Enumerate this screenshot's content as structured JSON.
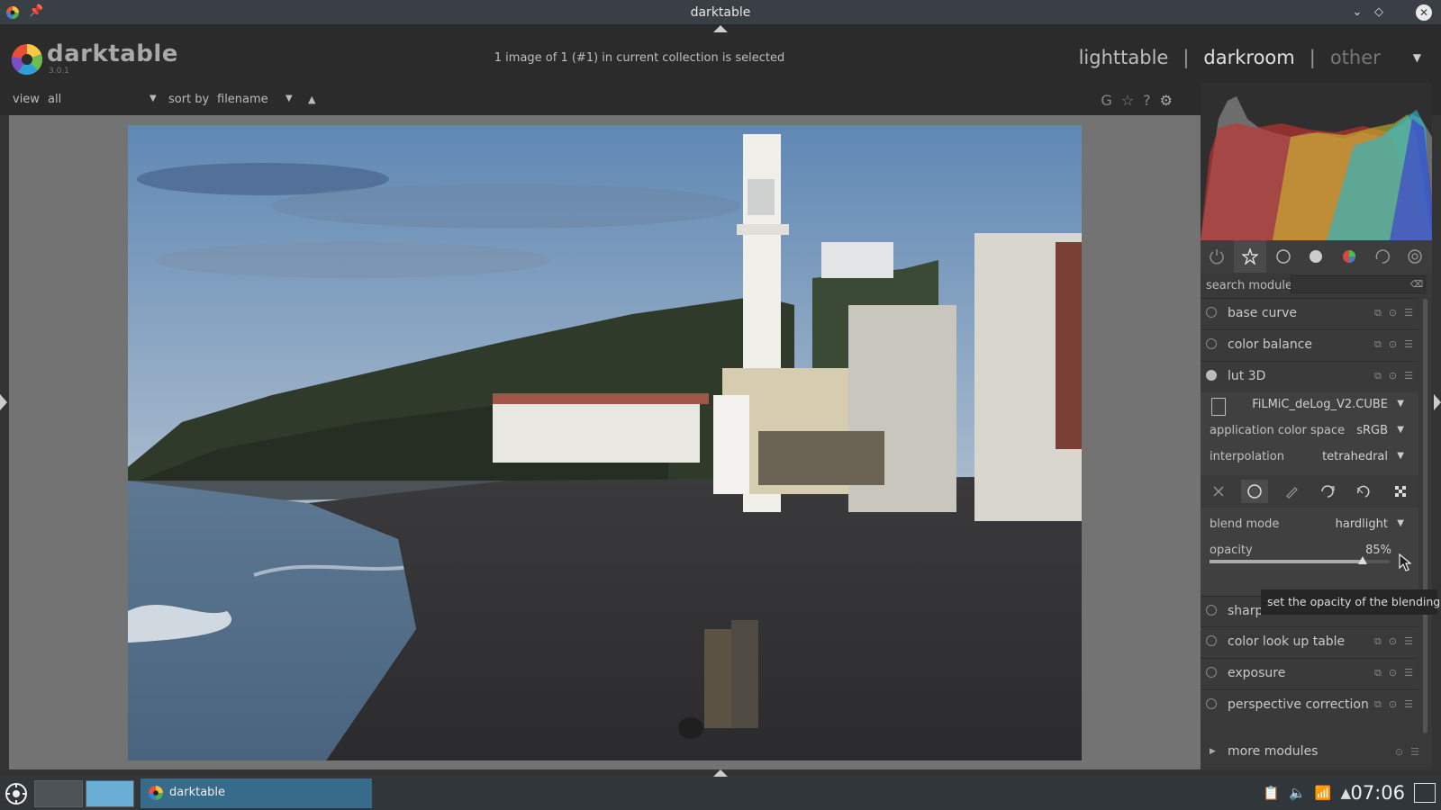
{
  "window": {
    "title": "darktable"
  },
  "header": {
    "brand": "darktable",
    "version": "3.0.1",
    "status": "1 image of 1 (#1) in current collection is selected",
    "views": {
      "lighttable": "lighttable",
      "darkroom": "darkroom",
      "other": "other",
      "sep": "|"
    }
  },
  "filterbar": {
    "view_label": "view",
    "view_value": "all",
    "sort_label": "sort by",
    "sort_value": "filename",
    "sort_dir": "▲",
    "icons": [
      "grouping-icon",
      "star-icon",
      "help-icon",
      "gear-icon"
    ],
    "grouping_glyph": "G",
    "star_glyph": "☆",
    "help_glyph": "?",
    "gear_glyph": "⚙"
  },
  "panel": {
    "search_label": "search module",
    "search_value": "",
    "modules_top": [
      {
        "name": "base curve",
        "enabled": false
      },
      {
        "name": "color balance",
        "enabled": false
      },
      {
        "name": "lut 3D",
        "enabled": true
      }
    ],
    "lut3d": {
      "file": "FiLMiC_deLog_V2.CUBE",
      "app_colorspace_label": "application color space",
      "app_colorspace_value": "sRGB",
      "interpolation_label": "interpolation",
      "interpolation_value": "tetrahedral",
      "blend_mode_label": "blend mode",
      "blend_mode_value": "hardlight",
      "opacity_label": "opacity",
      "opacity_value": "85%",
      "opacity_fraction": 0.85
    },
    "modules_bottom": [
      {
        "name": "sharp"
      },
      {
        "name": "color look up table"
      },
      {
        "name": "exposure"
      },
      {
        "name": "perspective correction"
      }
    ],
    "more_modules": "more modules",
    "tooltip": "set the opacity of the blending"
  },
  "taskbar": {
    "task_label": "darktable",
    "clock": "07:06"
  },
  "colors": {
    "accent": "#3daee9",
    "panel_bg": "#393939",
    "center_bg": "#737373"
  }
}
